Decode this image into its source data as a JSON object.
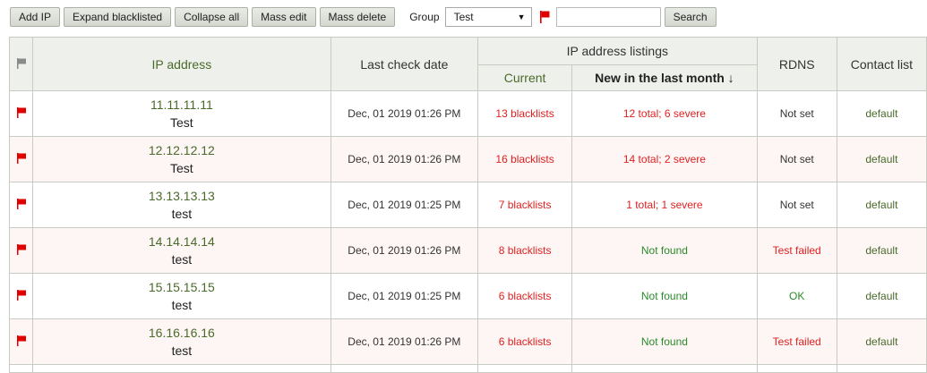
{
  "toolbar": {
    "add_ip": "Add IP",
    "expand": "Expand blacklisted",
    "collapse": "Collapse all",
    "mass_edit": "Mass edit",
    "mass_delete": "Mass delete",
    "group_label": "Group",
    "group_value": "Test",
    "search_value": "",
    "search_button": "Search",
    "flag_color": "#e00000"
  },
  "table": {
    "headers": {
      "ip": "IP address",
      "last_check": "Last check date",
      "listings": "IP address listings",
      "current": "Current",
      "new_month": "New in the last month ↓",
      "rdns": "RDNS",
      "contact": "Contact list"
    },
    "rows": [
      {
        "ip": "11.11.11.11",
        "group": "Test",
        "date": "Dec, 01 2019 01:26 PM",
        "current": "13 blacklists",
        "new": "12 total; 6 severe",
        "new_status": "red",
        "rdns": "Not set",
        "rdns_status": "neutral",
        "contact": "default"
      },
      {
        "ip": "12.12.12.12",
        "group": "Test",
        "date": "Dec, 01 2019 01:26 PM",
        "current": "16 blacklists",
        "new": "14 total; 2 severe",
        "new_status": "red",
        "rdns": "Not set",
        "rdns_status": "neutral",
        "contact": "default"
      },
      {
        "ip": "13.13.13.13",
        "group": "test",
        "date": "Dec, 01 2019 01:25 PM",
        "current": "7 blacklists",
        "new": "1 total; 1 severe",
        "new_status": "red",
        "rdns": "Not set",
        "rdns_status": "neutral",
        "contact": "default"
      },
      {
        "ip": "14.14.14.14",
        "group": "test",
        "date": "Dec, 01 2019 01:26 PM",
        "current": "8 blacklists",
        "new": "Not found",
        "new_status": "green",
        "rdns": "Test failed",
        "rdns_status": "bad",
        "contact": "default"
      },
      {
        "ip": "15.15.15.15",
        "group": "test",
        "date": "Dec, 01 2019 01:25 PM",
        "current": "6 blacklists",
        "new": "Not found",
        "new_status": "green",
        "rdns": "OK",
        "rdns_status": "good",
        "contact": "default"
      },
      {
        "ip": "16.16.16.16",
        "group": "test",
        "date": "Dec, 01 2019 01:26 PM",
        "current": "6 blacklists",
        "new": "Not found",
        "new_status": "green",
        "rdns": "Test failed",
        "rdns_status": "bad",
        "contact": "default"
      }
    ]
  }
}
